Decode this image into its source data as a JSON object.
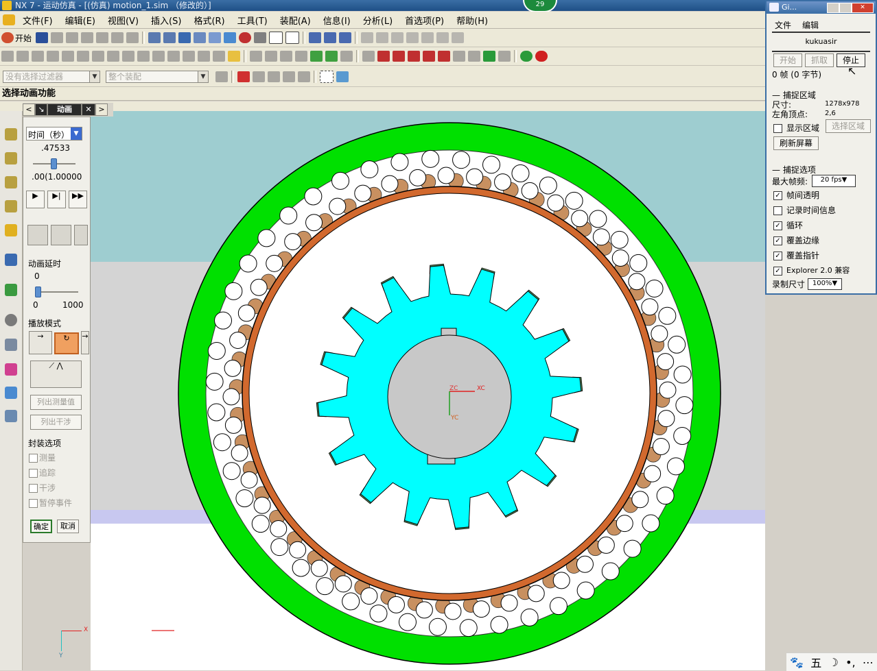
{
  "window": {
    "title": "NX 7 - 运动仿真 - [(仿真) motion_1.sim （修改的）]",
    "badge": "29"
  },
  "menubar": {
    "items": [
      "文件(F)",
      "编辑(E)",
      "视图(V)",
      "插入(S)",
      "格式(R)",
      "工具(T)",
      "装配(A)",
      "信息(I)",
      "分析(L)",
      "首选项(P)",
      "帮助(H)"
    ]
  },
  "toolbar": {
    "start_label": "开始"
  },
  "selection_bar": {
    "filter": "没有选择过滤器",
    "scope": "整个装配"
  },
  "cue_line": "选择动画功能",
  "animation_dialog": {
    "tab_title": "动画",
    "time_unit": "时间（秒）",
    "time_value": ".47533",
    "time_range": ".00(1.00000",
    "time_fraction": 0.475,
    "delay_label": "动画延时",
    "delay_value": "0",
    "delay_min": "0",
    "delay_max": "1000",
    "play_mode_label": "播放模式",
    "list_measure": "列出测量值",
    "list_interference": "列出干涉",
    "package_label": "封装选项",
    "options": [
      "测量",
      "追踪",
      "干涉",
      "暂停事件"
    ],
    "ok": "确定",
    "cancel": "取消"
  },
  "viewport": {
    "triad_x": "XC",
    "triad_y": "YC",
    "triad_z": "ZC",
    "corner_x": "X",
    "corner_y": "Y",
    "colors": {
      "outer_ring": "#00e000",
      "inner_ring": "#d2692e",
      "gear": "#00ffff",
      "tooth_tip": "#5a8a5a",
      "background_top": "#9ecdd0",
      "background_mid": "#d4d4d4"
    }
  },
  "capture_tool": {
    "title": "Gi...",
    "menu": [
      "文件",
      "编辑"
    ],
    "user": "kukuasir",
    "buttons": {
      "start": "开始",
      "grab": "抓取",
      "stop": "停止"
    },
    "frame_info": "0 帧 (0 字节)",
    "capture_region": "捕捉区域",
    "size_label": "尺寸:",
    "size_value": "1278x978",
    "corner_label": "左角顶点:",
    "corner_value": "2,6",
    "show_region": "显示区域",
    "select_region": "选择区域",
    "refresh": "刷新屏幕",
    "capture_options": "捕捉选项",
    "max_fps_label": "最大帧频:",
    "max_fps_value": "20 fps",
    "checks": [
      {
        "label": "帧间透明",
        "checked": true
      },
      {
        "label": "记录时间信息",
        "checked": false
      },
      {
        "label": "循环",
        "checked": true
      },
      {
        "label": "覆盖边缘",
        "checked": true
      },
      {
        "label": "覆盖指针",
        "checked": true
      },
      {
        "label": "Explorer 2.0 兼容",
        "checked": true
      }
    ],
    "record_size_label": "录制尺寸",
    "record_size_value": "100%"
  },
  "tray": {
    "ime": "五"
  }
}
